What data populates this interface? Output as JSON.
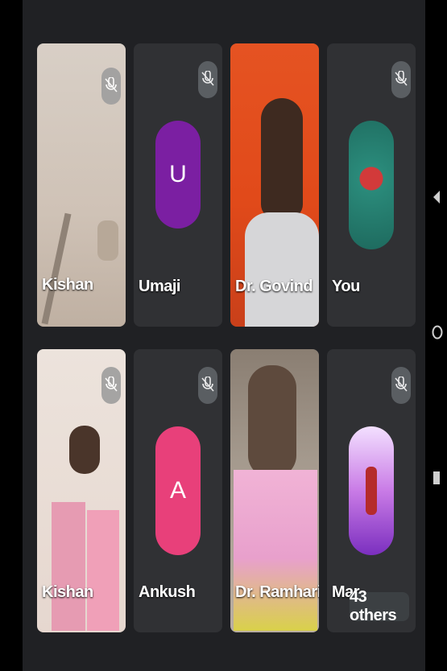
{
  "participants": [
    {
      "name": "Kishan",
      "type": "video",
      "muted": true
    },
    {
      "name": "Umaji",
      "type": "avatar",
      "initial": "U",
      "color": "#7b1fa2",
      "muted": true
    },
    {
      "name": "Dr. Govind",
      "type": "video",
      "muted": false
    },
    {
      "name": "You",
      "type": "avatar-photo",
      "muted": true
    },
    {
      "name": "Kishan",
      "type": "video",
      "muted": true
    },
    {
      "name": "Ankush",
      "type": "avatar",
      "initial": "A",
      "color": "#e8407a",
      "muted": true
    },
    {
      "name": "Dr. Ramhari",
      "type": "video",
      "muted": false
    },
    {
      "name": "Mar",
      "type": "avatar-photo",
      "muted": true
    }
  ],
  "others_label": "43 others",
  "nav": {
    "back": "back-icon",
    "home": "home-icon",
    "recents": "recents-icon"
  }
}
